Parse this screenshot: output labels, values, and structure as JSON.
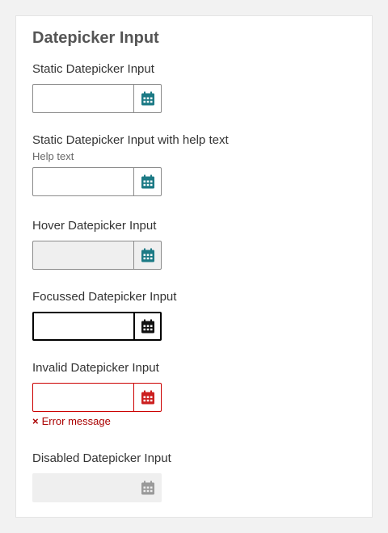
{
  "title": "Datepicker Input",
  "fields": [
    {
      "label": "Static Datepicker Input",
      "value": "",
      "icon": "calendar-icon",
      "icon_color": "#1c7a85"
    },
    {
      "label": "Static Datepicker Input with help text",
      "help": "Help text",
      "value": "",
      "icon": "calendar-icon",
      "icon_color": "#1c7a85"
    },
    {
      "label": "Hover Datepicker Input",
      "value": "",
      "icon": "calendar-icon",
      "icon_color": "#1c7a85"
    },
    {
      "label": "Focussed Datepicker Input",
      "value": "",
      "icon": "calendar-icon",
      "icon_color": "#111111"
    },
    {
      "label": "Invalid Datepicker Input",
      "value": "",
      "error": "Error message",
      "error_icon": "×",
      "icon": "calendar-icon",
      "icon_color": "#cc1f1f"
    },
    {
      "label": "Disabled Datepicker Input",
      "value": "",
      "icon": "calendar-icon",
      "icon_color": "#9a9a9a"
    }
  ]
}
